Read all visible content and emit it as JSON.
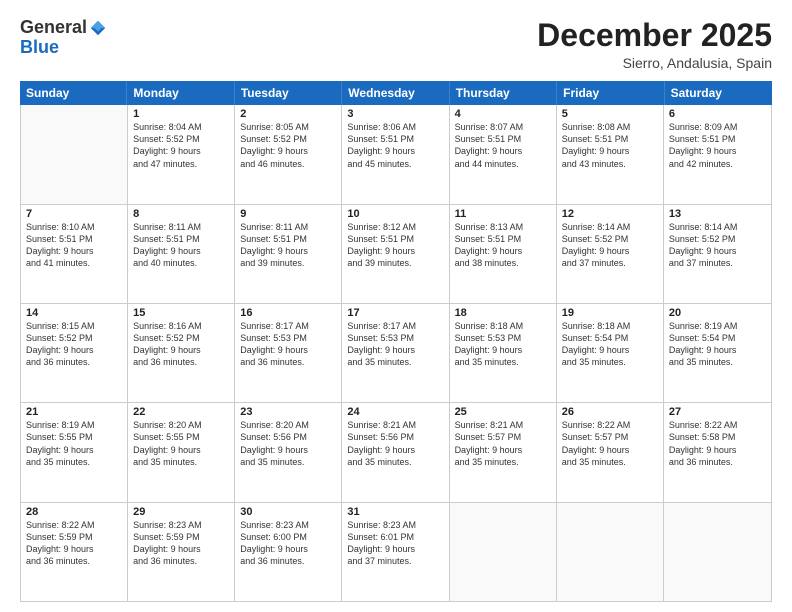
{
  "logo": {
    "general": "General",
    "blue": "Blue"
  },
  "title": "December 2025",
  "location": "Sierro, Andalusia, Spain",
  "weekdays": [
    "Sunday",
    "Monday",
    "Tuesday",
    "Wednesday",
    "Thursday",
    "Friday",
    "Saturday"
  ],
  "weeks": [
    [
      {
        "day": "",
        "info": ""
      },
      {
        "day": "1",
        "info": "Sunrise: 8:04 AM\nSunset: 5:52 PM\nDaylight: 9 hours\nand 47 minutes."
      },
      {
        "day": "2",
        "info": "Sunrise: 8:05 AM\nSunset: 5:52 PM\nDaylight: 9 hours\nand 46 minutes."
      },
      {
        "day": "3",
        "info": "Sunrise: 8:06 AM\nSunset: 5:51 PM\nDaylight: 9 hours\nand 45 minutes."
      },
      {
        "day": "4",
        "info": "Sunrise: 8:07 AM\nSunset: 5:51 PM\nDaylight: 9 hours\nand 44 minutes."
      },
      {
        "day": "5",
        "info": "Sunrise: 8:08 AM\nSunset: 5:51 PM\nDaylight: 9 hours\nand 43 minutes."
      },
      {
        "day": "6",
        "info": "Sunrise: 8:09 AM\nSunset: 5:51 PM\nDaylight: 9 hours\nand 42 minutes."
      }
    ],
    [
      {
        "day": "7",
        "info": "Sunrise: 8:10 AM\nSunset: 5:51 PM\nDaylight: 9 hours\nand 41 minutes."
      },
      {
        "day": "8",
        "info": "Sunrise: 8:11 AM\nSunset: 5:51 PM\nDaylight: 9 hours\nand 40 minutes."
      },
      {
        "day": "9",
        "info": "Sunrise: 8:11 AM\nSunset: 5:51 PM\nDaylight: 9 hours\nand 39 minutes."
      },
      {
        "day": "10",
        "info": "Sunrise: 8:12 AM\nSunset: 5:51 PM\nDaylight: 9 hours\nand 39 minutes."
      },
      {
        "day": "11",
        "info": "Sunrise: 8:13 AM\nSunset: 5:51 PM\nDaylight: 9 hours\nand 38 minutes."
      },
      {
        "day": "12",
        "info": "Sunrise: 8:14 AM\nSunset: 5:52 PM\nDaylight: 9 hours\nand 37 minutes."
      },
      {
        "day": "13",
        "info": "Sunrise: 8:14 AM\nSunset: 5:52 PM\nDaylight: 9 hours\nand 37 minutes."
      }
    ],
    [
      {
        "day": "14",
        "info": "Sunrise: 8:15 AM\nSunset: 5:52 PM\nDaylight: 9 hours\nand 36 minutes."
      },
      {
        "day": "15",
        "info": "Sunrise: 8:16 AM\nSunset: 5:52 PM\nDaylight: 9 hours\nand 36 minutes."
      },
      {
        "day": "16",
        "info": "Sunrise: 8:17 AM\nSunset: 5:53 PM\nDaylight: 9 hours\nand 36 minutes."
      },
      {
        "day": "17",
        "info": "Sunrise: 8:17 AM\nSunset: 5:53 PM\nDaylight: 9 hours\nand 35 minutes."
      },
      {
        "day": "18",
        "info": "Sunrise: 8:18 AM\nSunset: 5:53 PM\nDaylight: 9 hours\nand 35 minutes."
      },
      {
        "day": "19",
        "info": "Sunrise: 8:18 AM\nSunset: 5:54 PM\nDaylight: 9 hours\nand 35 minutes."
      },
      {
        "day": "20",
        "info": "Sunrise: 8:19 AM\nSunset: 5:54 PM\nDaylight: 9 hours\nand 35 minutes."
      }
    ],
    [
      {
        "day": "21",
        "info": "Sunrise: 8:19 AM\nSunset: 5:55 PM\nDaylight: 9 hours\nand 35 minutes."
      },
      {
        "day": "22",
        "info": "Sunrise: 8:20 AM\nSunset: 5:55 PM\nDaylight: 9 hours\nand 35 minutes."
      },
      {
        "day": "23",
        "info": "Sunrise: 8:20 AM\nSunset: 5:56 PM\nDaylight: 9 hours\nand 35 minutes."
      },
      {
        "day": "24",
        "info": "Sunrise: 8:21 AM\nSunset: 5:56 PM\nDaylight: 9 hours\nand 35 minutes."
      },
      {
        "day": "25",
        "info": "Sunrise: 8:21 AM\nSunset: 5:57 PM\nDaylight: 9 hours\nand 35 minutes."
      },
      {
        "day": "26",
        "info": "Sunrise: 8:22 AM\nSunset: 5:57 PM\nDaylight: 9 hours\nand 35 minutes."
      },
      {
        "day": "27",
        "info": "Sunrise: 8:22 AM\nSunset: 5:58 PM\nDaylight: 9 hours\nand 36 minutes."
      }
    ],
    [
      {
        "day": "28",
        "info": "Sunrise: 8:22 AM\nSunset: 5:59 PM\nDaylight: 9 hours\nand 36 minutes."
      },
      {
        "day": "29",
        "info": "Sunrise: 8:23 AM\nSunset: 5:59 PM\nDaylight: 9 hours\nand 36 minutes."
      },
      {
        "day": "30",
        "info": "Sunrise: 8:23 AM\nSunset: 6:00 PM\nDaylight: 9 hours\nand 36 minutes."
      },
      {
        "day": "31",
        "info": "Sunrise: 8:23 AM\nSunset: 6:01 PM\nDaylight: 9 hours\nand 37 minutes."
      },
      {
        "day": "",
        "info": ""
      },
      {
        "day": "",
        "info": ""
      },
      {
        "day": "",
        "info": ""
      }
    ]
  ]
}
